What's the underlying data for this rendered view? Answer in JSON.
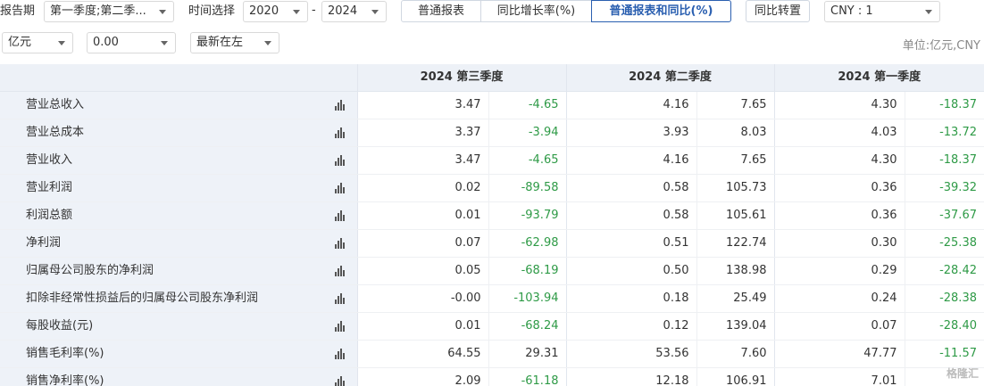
{
  "filters": {
    "report_period_label": "报告期",
    "report_period_value": "第一季度;第二季...",
    "time_select_label": "时间选择",
    "year_from": "2020",
    "range_sep": "-",
    "year_to": "2024",
    "view_buttons": [
      "普通报表",
      "同比增长率(%)",
      "普通报表和同比(%)"
    ],
    "active_view": "普通报表和同比(%)",
    "transpose_button": "同比转置",
    "currency": "CNY : 1",
    "unit": "亿元",
    "decimals": "0.00",
    "order": "最新在左",
    "unit_note": "单位:亿元,CNY"
  },
  "table": {
    "periods": [
      "2024 第三季度",
      "2024 第二季度",
      "2024 第一季度"
    ],
    "rows": [
      {
        "name": "营业总收入",
        "cells": [
          "3.47",
          "-4.65",
          "4.16",
          "7.65",
          "4.30",
          "-18.37"
        ]
      },
      {
        "name": "营业总成本",
        "cells": [
          "3.37",
          "-3.94",
          "3.93",
          "8.03",
          "4.03",
          "-13.72"
        ]
      },
      {
        "name": "营业收入",
        "cells": [
          "3.47",
          "-4.65",
          "4.16",
          "7.65",
          "4.30",
          "-18.37"
        ]
      },
      {
        "name": "营业利润",
        "cells": [
          "0.02",
          "-89.58",
          "0.58",
          "105.73",
          "0.36",
          "-39.32"
        ]
      },
      {
        "name": "利润总额",
        "cells": [
          "0.01",
          "-93.79",
          "0.58",
          "105.61",
          "0.36",
          "-37.67"
        ]
      },
      {
        "name": "净利润",
        "cells": [
          "0.07",
          "-62.98",
          "0.51",
          "122.74",
          "0.30",
          "-25.38"
        ]
      },
      {
        "name": "归属母公司股东的净利润",
        "cells": [
          "0.05",
          "-68.19",
          "0.50",
          "138.98",
          "0.29",
          "-28.42"
        ]
      },
      {
        "name": "扣除非经常性损益后的归属母公司股东净利润",
        "cells": [
          "-0.00",
          "-103.94",
          "0.18",
          "25.49",
          "0.24",
          "-28.38"
        ]
      },
      {
        "name": "每股收益(元)",
        "cells": [
          "0.01",
          "-68.24",
          "0.12",
          "139.04",
          "0.07",
          "-28.40"
        ]
      },
      {
        "name": "销售毛利率(%)",
        "cells": [
          "64.55",
          "29.31",
          "53.56",
          "7.60",
          "47.77",
          "-11.57"
        ]
      },
      {
        "name": "销售净利率(%)",
        "cells": [
          "2.09",
          "-61.18",
          "12.18",
          "106.91",
          "7.01",
          ""
        ]
      }
    ]
  },
  "watermark": "格隆汇",
  "colors": {
    "negative": "#2e9a46",
    "active": "#2a5fb0",
    "row_header_bg": "#eef2f8"
  }
}
